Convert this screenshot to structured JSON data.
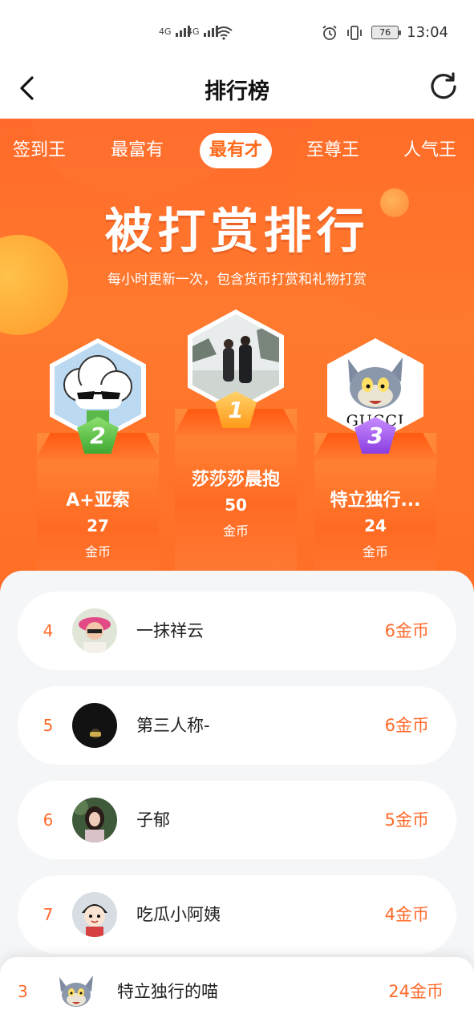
{
  "status_bar": {
    "signal_1": "4G",
    "signal_2": "4G",
    "battery": "76",
    "time": "13:04"
  },
  "header": {
    "title": "排行榜"
  },
  "tabs": [
    {
      "label": "签到王",
      "active": false
    },
    {
      "label": "最富有",
      "active": false
    },
    {
      "label": "最有才",
      "active": true
    },
    {
      "label": "至尊王",
      "active": false
    },
    {
      "label": "人气王",
      "active": false
    }
  ],
  "banner": {
    "title": "被打赏排行",
    "subtitle": "每小时更新一次，包含货币打赏和礼物打赏"
  },
  "podium": {
    "first": {
      "rank": "1",
      "name": "莎莎莎晨抱",
      "amount": "50",
      "unit": "金币"
    },
    "second": {
      "rank": "2",
      "name": "A+亚索",
      "amount": "27",
      "unit": "金币"
    },
    "third": {
      "rank": "3",
      "name": "特立独行...",
      "amount": "24",
      "unit": "金币"
    }
  },
  "ranking": [
    {
      "rank": "4",
      "name": "一抹祥云",
      "coins": "6金币"
    },
    {
      "rank": "5",
      "name": "第三人称-",
      "coins": "6金币"
    },
    {
      "rank": "6",
      "name": "子郁",
      "coins": "5金币"
    },
    {
      "rank": "7",
      "name": "吃瓜小阿姨",
      "coins": "4金币"
    }
  ],
  "my_rank": {
    "rank": "3",
    "name": "特立独行的喵",
    "coins": "24金币"
  },
  "colors": {
    "accent": "#ff6a2a",
    "gold": "#ffb020",
    "silver_badge": "#5cc04a",
    "bronze_badge": "#9a55e0"
  },
  "icons": {
    "back": "chevron-left-icon",
    "refresh": "refresh-icon"
  }
}
